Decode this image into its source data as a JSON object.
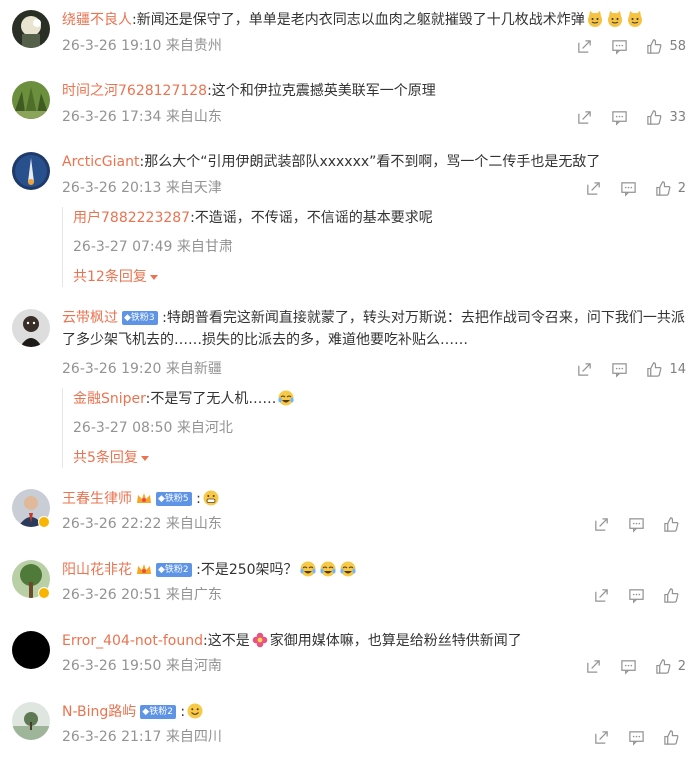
{
  "comments": [
    {
      "user": "绕疆不良人",
      "text": ":新闻还是保守了，单单是老内衣同志以血肉之躯就摧毁了十几枚战术炸弹",
      "time": "26-3-26 19:10 来自贵州",
      "likes": "58",
      "emojis": [
        "cat-doge-emoji",
        "cat-doge-emoji",
        "cat-doge-emoji"
      ]
    },
    {
      "user": "时间之河7628127128",
      "text": ":这个和伊拉克震撼英美联军一个原理",
      "time": "26-3-26 17:34 来自山东",
      "likes": "33"
    },
    {
      "user": "ArcticGiant",
      "text": ":那么大个“引用伊朗武装部队xxxxxx”看不到啊，骂一个二传手也是无敌了",
      "time": "26-3-26 20:13 来自天津",
      "likes": "2",
      "reply": {
        "user": "用户7882223287",
        "text": ":不造谣，不传谣，不信谣的基本要求呢",
        "time": "26-3-27 07:49 来自甘肃",
        "more": "共12条回复"
      }
    },
    {
      "user": "云带枫过",
      "badge": "铁粉3",
      "text": ":特朗普看完这新闻直接就蒙了，转头对万斯说：去把作战司令召来，问下我们一共派了多少架飞机去的……损失的比派去的多，难道他要吃补贴么……",
      "time": "26-3-26 19:20 来自新疆",
      "likes": "14",
      "reply": {
        "user": "金融Sniper",
        "text": ":不是写了无人机……",
        "time": "26-3-27 08:50 来自河北",
        "more": "共5条回复",
        "emojis": [
          "laugh-cry-emoji"
        ]
      }
    },
    {
      "user": "王春生律师",
      "badge": "铁粉5",
      "text": ":",
      "time": "26-3-26 22:22 来自山东",
      "likes": "",
      "emojis": [
        "grin-emoji"
      ]
    },
    {
      "user": "阳山花非花",
      "badge": "铁粉2",
      "text": ":不是250架吗？",
      "time": "26-3-26 20:51 来自广东",
      "likes": "",
      "emojis": [
        "laugh-cry-emoji",
        "laugh-cry-emoji",
        "laugh-cry-emoji"
      ]
    },
    {
      "user": "Error_404-not-found",
      "text_a": ":这不是",
      "text_b": "家御用媒体嘛，也算是给粉丝特供新闻了",
      "time": "26-3-26 19:50 来自河南",
      "likes": "2",
      "emojis": [
        "flower-emoji"
      ]
    },
    {
      "user": "N-Bing路屿",
      "badge": "铁粉2",
      "text": ":",
      "time": "26-3-26 21:17 来自四川",
      "likes": "",
      "emojis": [
        "smile-emoji"
      ]
    }
  ],
  "colors": {
    "username": "#eb7350",
    "meta": "#939393",
    "badge": "#5e94e6",
    "reply_more": "#eb7350"
  }
}
